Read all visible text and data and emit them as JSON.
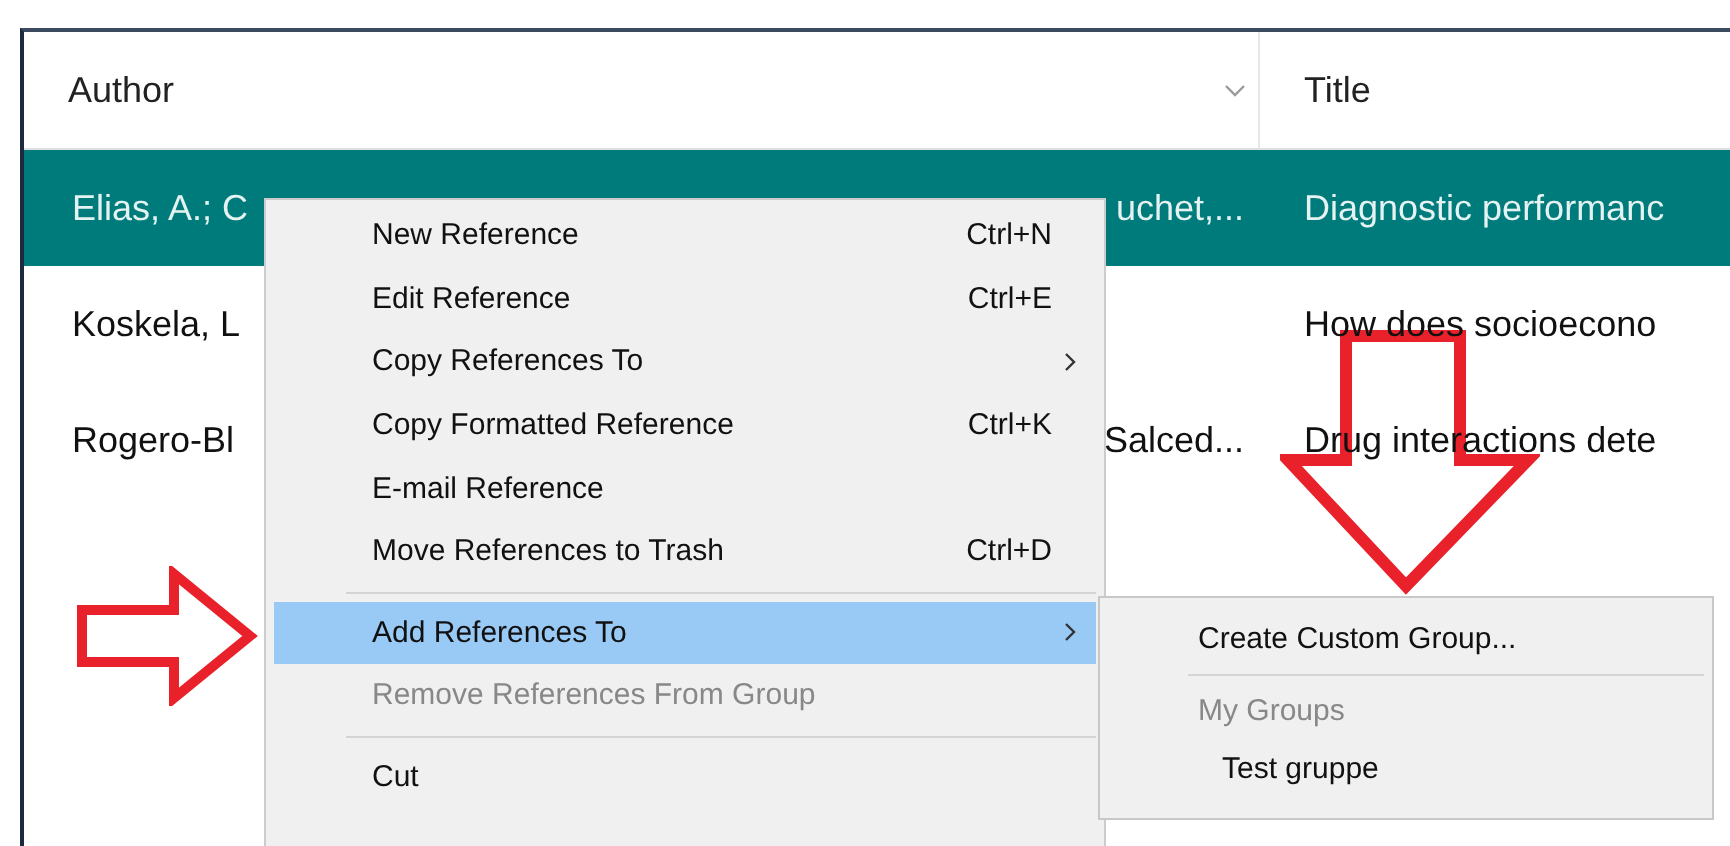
{
  "table": {
    "columns": [
      {
        "label": "Author",
        "sort_chevron": true
      },
      {
        "label": "Title",
        "sort_chevron": false
      }
    ],
    "rows": [
      {
        "selected": true,
        "author_start": "Elias, A.; C",
        "author_end": "uchet,...",
        "title": "Diagnostic performanc"
      },
      {
        "selected": false,
        "author_start": "Koskela, L",
        "author_end": "",
        "title": "How does socioecono"
      },
      {
        "selected": false,
        "author_start": "Rogero-Bl",
        "author_end": "Salced...",
        "title": "Drug interactions dete"
      }
    ]
  },
  "context_menu": {
    "items": [
      {
        "kind": "item",
        "label": "New Reference",
        "shortcut": "Ctrl+N",
        "submenu": false,
        "selected": false,
        "disabled": false
      },
      {
        "kind": "item",
        "label": "Edit Reference",
        "shortcut": "Ctrl+E",
        "submenu": false,
        "selected": false,
        "disabled": false
      },
      {
        "kind": "item",
        "label": "Copy References To",
        "submenu": true,
        "selected": false,
        "disabled": false
      },
      {
        "kind": "item",
        "label": "Copy Formatted Reference",
        "shortcut": "Ctrl+K",
        "submenu": false,
        "selected": false,
        "disabled": false
      },
      {
        "kind": "item",
        "label": "E-mail Reference",
        "submenu": false,
        "selected": false,
        "disabled": false
      },
      {
        "kind": "item",
        "label": "Move References to Trash",
        "shortcut": "Ctrl+D",
        "submenu": false,
        "selected": false,
        "disabled": false
      },
      {
        "kind": "separator"
      },
      {
        "kind": "item",
        "label": "Add References To",
        "submenu": true,
        "selected": true,
        "disabled": false
      },
      {
        "kind": "item",
        "label": "Remove References From Group",
        "submenu": false,
        "selected": false,
        "disabled": true
      },
      {
        "kind": "separator"
      },
      {
        "kind": "item",
        "label": "Cut",
        "submenu": false,
        "selected": false,
        "disabled": false
      }
    ]
  },
  "submenu": {
    "items": [
      {
        "kind": "item",
        "label": "Create Custom Group..."
      },
      {
        "kind": "separator"
      },
      {
        "kind": "header",
        "label": "My Groups"
      },
      {
        "kind": "group",
        "label": "Test gruppe"
      }
    ]
  },
  "annotations": [
    {
      "kind": "right_arrow"
    },
    {
      "kind": "down_arrow"
    }
  ]
}
